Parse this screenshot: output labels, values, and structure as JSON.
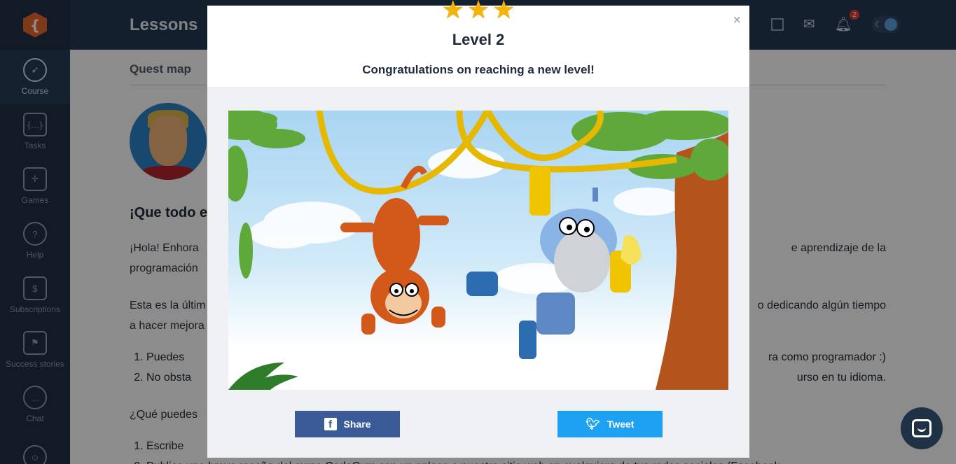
{
  "sidebar": {
    "logo_glyph": "{",
    "items": [
      {
        "label": "Course",
        "icon": "rocket-icon"
      },
      {
        "label": "Tasks",
        "icon": "code-icon"
      },
      {
        "label": "Games",
        "icon": "gamepad-icon"
      },
      {
        "label": "Help",
        "icon": "help-icon"
      },
      {
        "label": "Subscriptions",
        "icon": "dollar-icon"
      },
      {
        "label": "Success stories",
        "icon": "flag-icon"
      },
      {
        "label": "Chat",
        "icon": "chat-icon"
      },
      {
        "label": "",
        "icon": "community-icon"
      }
    ]
  },
  "header": {
    "title": "Lessons",
    "notification_count": "2"
  },
  "main": {
    "tab": "Quest map",
    "heading": "¡Que todo e",
    "para1_left": "¡Hola! Enhora",
    "para1_right": "e aprendizaje de la",
    "para1_line2": "programación",
    "para2_left": "Esta es la últim",
    "para2_right": "o dedicando algún tiempo",
    "para2_line2": "a hacer mejora",
    "list1": [
      {
        "left": "Puedes",
        "right": "ra como programador :)"
      },
      {
        "left": "No obsta",
        "right": "urso en tu idioma."
      }
    ],
    "question": "¿Qué puedes",
    "list2": [
      "Escribe",
      "Publica una breve reseña del curso CodeGym con un enlace a nuestro sitio web en cualquiera de tus redes sociales (Facebook"
    ]
  },
  "modal": {
    "stars": 3,
    "title": "Level 2",
    "subtitle": "Congratulations on reaching a new level!",
    "close": "×",
    "share_label": "Share",
    "tweet_label": "Tweet"
  },
  "colors": {
    "sidebar": "#1f3144",
    "topbar": "#243a52",
    "facebook": "#3b5b98",
    "twitter": "#1da1f2",
    "star": "#f5b400"
  }
}
